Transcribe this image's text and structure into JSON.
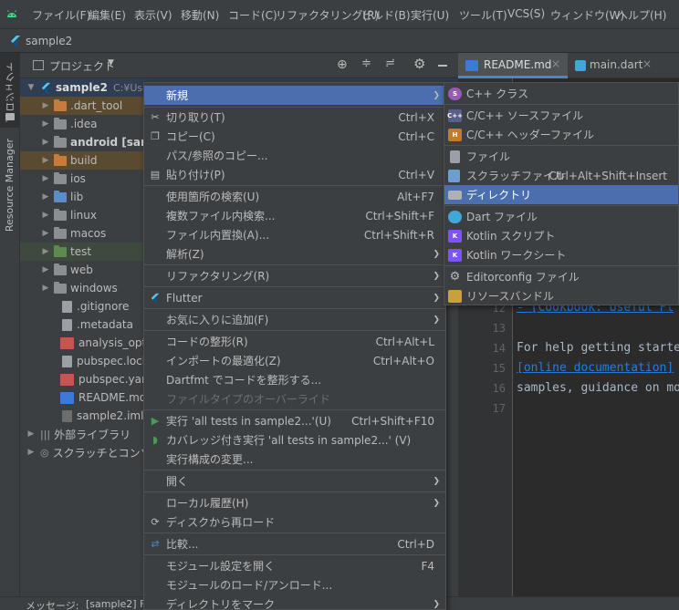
{
  "menubar": {
    "items": [
      "ファイル(F)",
      "編集(E)",
      "表示(V)",
      "移動(N)",
      "コード(C)",
      "リファクタリング(R)",
      "ビルド(B)",
      "実行(U)",
      "ツール(T)",
      "VCS(S)",
      "ウィンドウ(W)",
      "ヘルプ(H)"
    ]
  },
  "nav": {
    "project_name": "sample2"
  },
  "left_strip": {
    "project_label": "プロジェクト",
    "resource_manager_label": "Resource Manager"
  },
  "project_panel": {
    "view_label": "プロジェクト"
  },
  "tree": {
    "root": {
      "name": "sample2",
      "path": "C:¥Users"
    },
    "items": [
      {
        "label": "android [samp",
        "kind": "folder"
      },
      {
        "label": ".dart_tool",
        "kind": "excluded"
      },
      {
        "label": ".idea",
        "kind": "folder"
      },
      {
        "label": "android [samp",
        "kind": "folder"
      },
      {
        "label": "build",
        "kind": "excluded"
      },
      {
        "label": "ios",
        "kind": "folder"
      },
      {
        "label": "lib",
        "kind": "source"
      },
      {
        "label": "linux",
        "kind": "folder"
      },
      {
        "label": "macos",
        "kind": "folder"
      },
      {
        "label": "test",
        "kind": "test"
      },
      {
        "label": "web",
        "kind": "folder"
      },
      {
        "label": "windows",
        "kind": "folder"
      },
      {
        "label": ".gitignore",
        "kind": "file"
      },
      {
        "label": ".metadata",
        "kind": "file"
      },
      {
        "label": "analysis_optio",
        "kind": "yml"
      },
      {
        "label": "pubspec.lock",
        "kind": "file"
      },
      {
        "label": "pubspec.yaml",
        "kind": "yml"
      },
      {
        "label": "README.md",
        "kind": "md"
      },
      {
        "label": "sample2.iml",
        "kind": "iml"
      }
    ],
    "external_libraries": "外部ライブラリ",
    "scratches": "スクラッチとコンソール"
  },
  "editor": {
    "tabs": [
      {
        "label": "README.md",
        "active": true
      },
      {
        "label": "main.dart",
        "active": false
      }
    ],
    "lines": [
      {
        "num": "12",
        "text": "- [Cookbook: Useful Fl",
        "link": true
      },
      {
        "num": "13",
        "text": ""
      },
      {
        "num": "14",
        "text": "For help getting starte"
      },
      {
        "num": "15",
        "text": "[online documentation]",
        "link": true
      },
      {
        "num": "16",
        "text": "samples, guidance on mo"
      },
      {
        "num": "17",
        "text": ""
      }
    ]
  },
  "status": {
    "label": "メッセージ:",
    "text": "[sample2] Fl"
  },
  "context_menu": {
    "items": [
      {
        "label": "新規",
        "shortcut": "",
        "submenu": true,
        "highlighted": true,
        "icon": ""
      },
      {
        "label": "切り取り(T)",
        "shortcut": "Ctrl+X",
        "icon": "cut-icon"
      },
      {
        "label": "コピー(C)",
        "shortcut": "Ctrl+C",
        "icon": "copy-icon"
      },
      {
        "label": "パス/参照のコピー...",
        "shortcut": ""
      },
      {
        "label": "貼り付け(P)",
        "shortcut": "Ctrl+V",
        "icon": "paste-icon"
      },
      {
        "label": "使用箇所の検索(U)",
        "shortcut": "Alt+F7"
      },
      {
        "label": "複数ファイル内検索...",
        "shortcut": "Ctrl+Shift+F"
      },
      {
        "label": "ファイル内置換(A)...",
        "shortcut": "Ctrl+Shift+R"
      },
      {
        "label": "解析(Z)",
        "submenu": true
      },
      {
        "label": "リファクタリング(R)",
        "submenu": true
      },
      {
        "label": "Flutter",
        "submenu": true,
        "icon": "flutter-icon"
      },
      {
        "label": "お気に入りに追加(F)",
        "submenu": true
      },
      {
        "label": "コードの整形(R)",
        "shortcut": "Ctrl+Alt+L"
      },
      {
        "label": "インポートの最適化(Z)",
        "shortcut": "Ctrl+Alt+O"
      },
      {
        "label": "Dartfmt でコードを整形する...",
        "shortcut": ""
      },
      {
        "label": "ファイルタイプのオーバーライド",
        "disabled": true
      },
      {
        "label": "実行 'all tests in sample2...'(U)",
        "shortcut": "Ctrl+Shift+F10",
        "icon": "run-icon"
      },
      {
        "label": "カバレッジ付き実行 'all tests in sample2...' (V)",
        "icon": "coverage-icon"
      },
      {
        "label": "実行構成の変更...",
        "shortcut": ""
      },
      {
        "label": "開く",
        "submenu": true
      },
      {
        "label": "ローカル履歴(H)",
        "submenu": true
      },
      {
        "label": "ディスクから再ロード",
        "icon": "reload-icon"
      },
      {
        "label": "比較...",
        "shortcut": "Ctrl+D",
        "icon": "compare-icon"
      },
      {
        "label": "モジュール設定を開く",
        "shortcut": "F4"
      },
      {
        "label": "モジュールのロード/アンロード...",
        "shortcut": ""
      },
      {
        "label": "ディレクトリをマーク",
        "submenu": true
      }
    ]
  },
  "submenu": {
    "items": [
      {
        "label": "C++ クラス",
        "icon": "S"
      },
      {
        "label": "C/C++ ソースファイル",
        "icon": "C++"
      },
      {
        "label": "C/C++ ヘッダーファイル",
        "icon": "H"
      },
      {
        "label": "ファイル",
        "icon": ""
      },
      {
        "label": "スクラッチファイル",
        "shortcut": "Ctrl+Alt+Shift+Insert",
        "icon": ""
      },
      {
        "label": "ディレクトリ",
        "highlighted": true,
        "icon": ""
      },
      {
        "label": "Dart ファイル",
        "icon": ""
      },
      {
        "label": "Kotlin スクリプト",
        "icon": "K"
      },
      {
        "label": "Kotlin ワークシート",
        "icon": "K"
      },
      {
        "label": "Editorconfig ファイル",
        "icon": ""
      },
      {
        "label": "リソースバンドル",
        "icon": ""
      }
    ]
  },
  "colors": {
    "highlight": "#4b6eaf",
    "panel": "#3c3f41",
    "editor": "#2b2b2b",
    "link": "#287bde"
  }
}
